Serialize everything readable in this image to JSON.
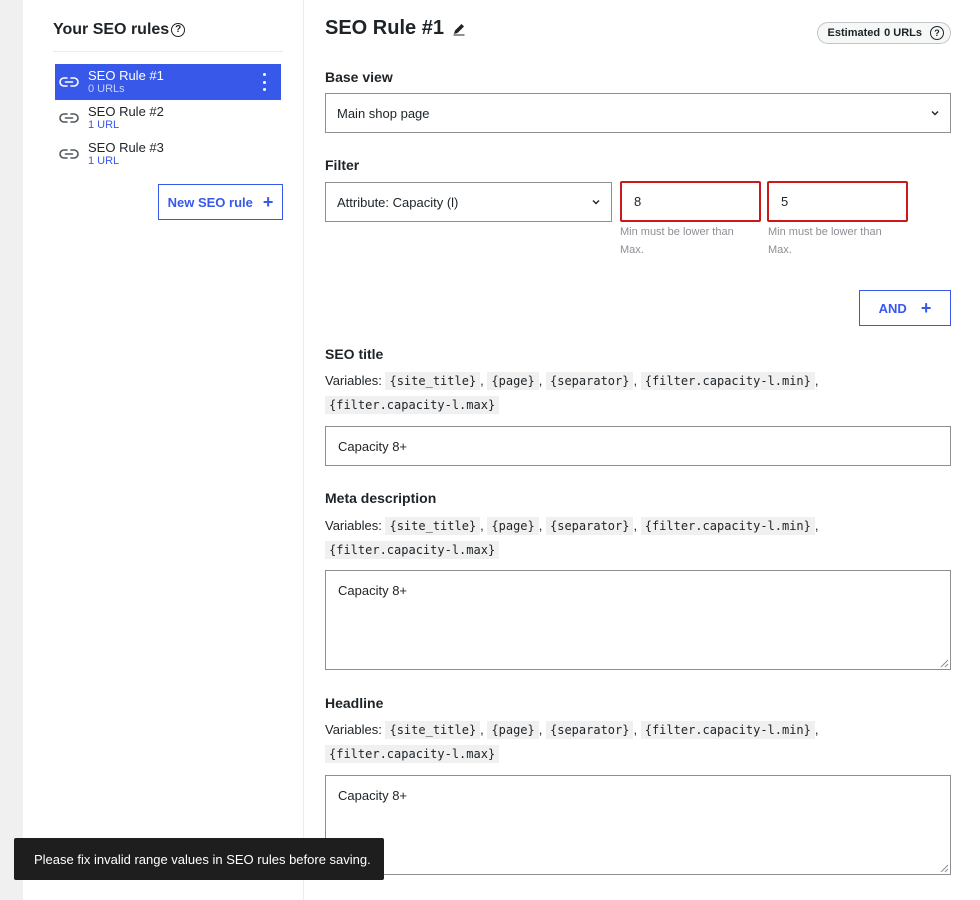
{
  "sidebar": {
    "title": "Your SEO rules",
    "rules": [
      {
        "name": "SEO Rule #1",
        "count": "0 URLs"
      },
      {
        "name": "SEO Rule #2",
        "count": "1 URL"
      },
      {
        "name": "SEO Rule #3",
        "count": "1 URL"
      }
    ],
    "new_rule_label": "New SEO rule"
  },
  "main": {
    "title": "SEO Rule #1",
    "estimate_prefix": "Estimated",
    "estimate_count": "0 URLs",
    "base_view": {
      "label": "Base view",
      "value": "Main shop page"
    },
    "filter": {
      "label": "Filter",
      "attribute": "Attribute: Capacity (l)",
      "min_value": "8",
      "max_value": "5",
      "min_error": "Min must be lower than Max.",
      "max_error": "Min must be lower than Max.",
      "and_label": "AND"
    },
    "variables_prefix": "Variables:",
    "variables": [
      "{site_title}",
      "{page}",
      "{separator}",
      "{filter.capacity-l.min}",
      "{filter.capacity-l.max}"
    ],
    "seo_title": {
      "label": "SEO title",
      "value": "Capacity 8+"
    },
    "meta_description": {
      "label": "Meta description",
      "value": "Capacity 8+"
    },
    "headline": {
      "label": "Headline",
      "value": "Capacity 8+"
    }
  },
  "toast": {
    "message": "Please fix invalid range values in SEO rules before saving."
  },
  "colors": {
    "accent": "#3858e9",
    "error": "#cc1818",
    "toast_bg": "#1e1e1e"
  }
}
